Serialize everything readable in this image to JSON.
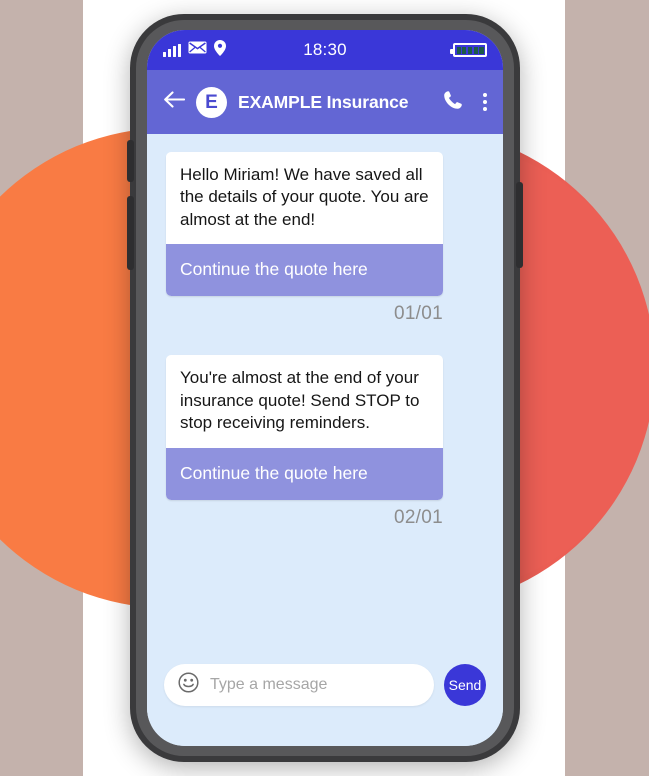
{
  "theme": {
    "backdrop": "#c4b2ac",
    "panel": "#ffffff",
    "circle_orange": "#f97b44",
    "circle_red": "#ec5f55",
    "status_bar": "#3a37d8",
    "header": "#6366d4",
    "chat_background": "#dcebfb",
    "bubble": "#ffffff",
    "cta": "#8f92de",
    "timestamp": "#8d8d8d",
    "send": "#3a37d8"
  },
  "status_bar": {
    "time": "18:30",
    "signal_icon": "signal-bars-icon",
    "mail_icon": "envelope-icon",
    "location_icon": "location-pin-icon",
    "battery_icon": "battery-full-icon",
    "battery_segments": 5
  },
  "header": {
    "back_icon": "back-arrow-icon",
    "avatar_letter": "E",
    "title": "EXAMPLE Insurance",
    "call_icon": "phone-icon",
    "menu_icon": "kebab-menu-icon"
  },
  "messages": [
    {
      "text": "Hello Miriam! We have saved all the details of your quote. You are almost at the end!",
      "cta": "Continue the quote here",
      "timestamp": "01/01"
    },
    {
      "text": "You're almost at the end of your insurance quote! Send STOP to stop receiving reminders.",
      "cta": "Continue the quote here",
      "timestamp": "02/01"
    }
  ],
  "composer": {
    "emoji_icon": "smiley-face-icon",
    "placeholder": "Type a message",
    "send_label": "Send"
  }
}
